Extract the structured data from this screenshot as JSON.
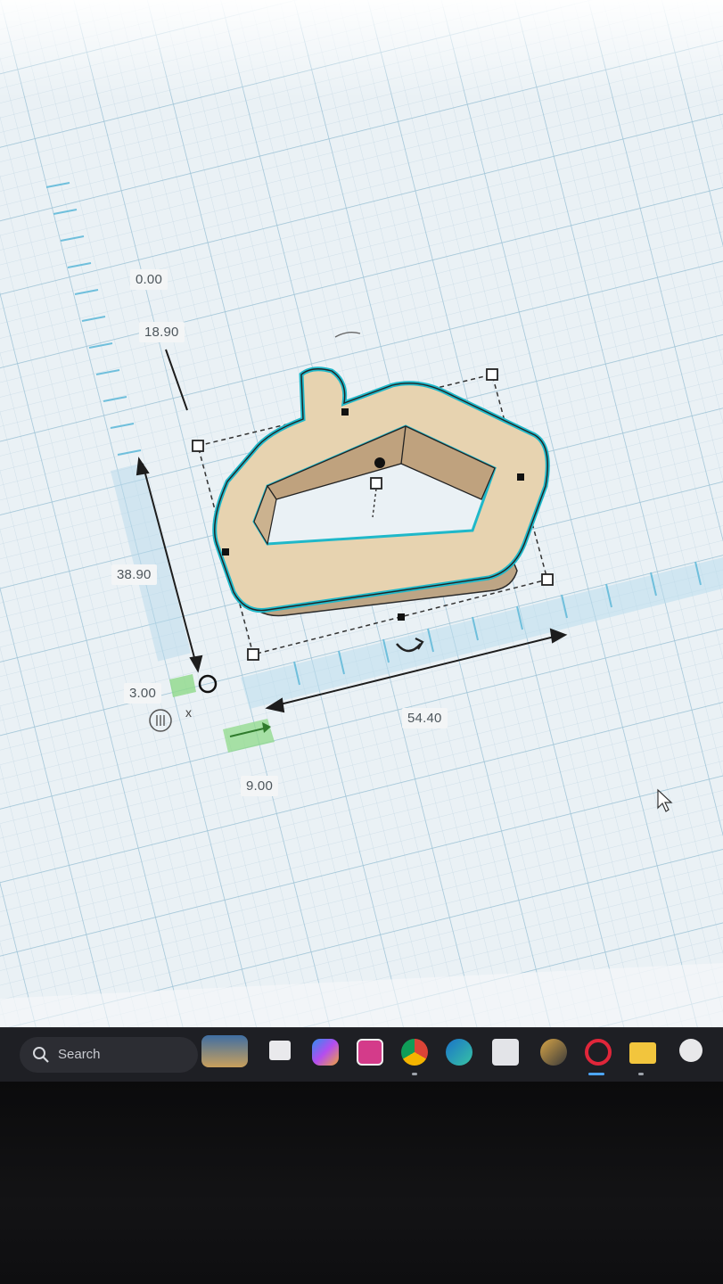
{
  "app": {
    "name": "3D design workplane",
    "accent_color": "#1fb8c9",
    "shape_color": "#e7d3b0"
  },
  "dimensions": {
    "elevation": "0.00",
    "height_top": "18.90",
    "length_y": "38.90",
    "offset_y": "3.00",
    "offset_x": "9.00",
    "width_x": "54.40"
  },
  "workplane": {
    "axis_marker": "x",
    "ruler_icon": "ruler-icon",
    "rotate_icon": "rotate-arrow-icon",
    "cursor": "mouse-pointer-icon"
  },
  "taskbar": {
    "search_placeholder": "Search",
    "icons": [
      "widgets-icon",
      "task-view-icon",
      "copilot-icon",
      "app-icon",
      "chrome-icon",
      "edge-icon",
      "store-icon",
      "game-icon",
      "opera-icon",
      "file-explorer-icon",
      "app-circle-icon"
    ]
  }
}
